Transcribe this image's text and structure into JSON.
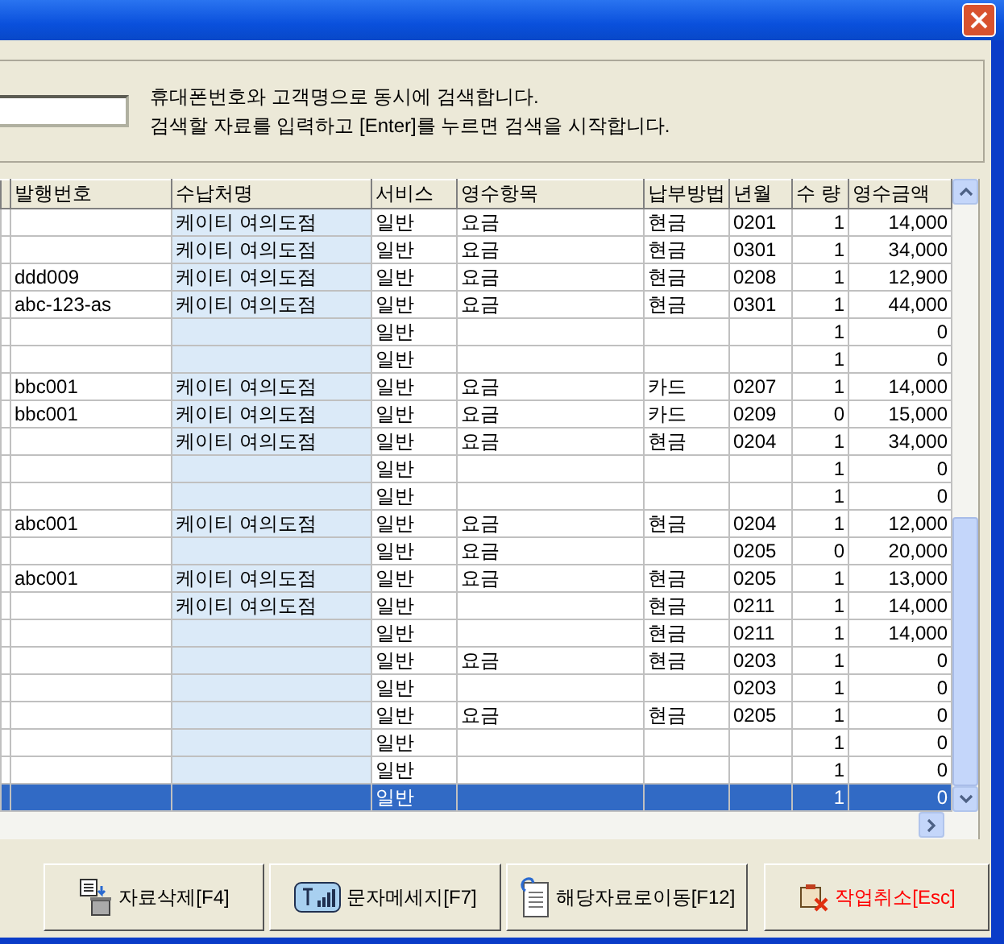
{
  "search": {
    "hint_lines": [
      "휴대폰번호와 고객명으로 동시에 검색합니다.",
      "검색할 자료를 입력하고 [Enter]를 누르면 검색을 시작합니다."
    ]
  },
  "table": {
    "columns": [
      "발행번호",
      "수납처명",
      "서비스",
      "영수항목",
      "납부방법",
      "년월",
      "수 량",
      "영수금액"
    ],
    "rows": [
      {
        "cells": [
          "",
          "케이티 여의도점",
          "일반",
          "요금",
          "현금",
          "0201",
          "1",
          "14,000"
        ],
        "selected": false
      },
      {
        "cells": [
          "",
          "케이티 여의도점",
          "일반",
          "요금",
          "현금",
          "0301",
          "1",
          "34,000"
        ],
        "selected": false
      },
      {
        "cells": [
          "ddd009",
          "케이티 여의도점",
          "일반",
          "요금",
          "현금",
          "0208",
          "1",
          "12,900"
        ],
        "selected": false
      },
      {
        "cells": [
          "abc-123-as",
          "케이티 여의도점",
          "일반",
          "요금",
          "현금",
          "0301",
          "1",
          "44,000"
        ],
        "selected": false
      },
      {
        "cells": [
          "",
          "",
          "일반",
          "",
          "",
          "",
          "1",
          "0"
        ],
        "selected": false
      },
      {
        "cells": [
          "",
          "",
          "일반",
          "",
          "",
          "",
          "1",
          "0"
        ],
        "selected": false
      },
      {
        "cells": [
          "bbc001",
          "케이티 여의도점",
          "일반",
          "요금",
          "카드",
          "0207",
          "1",
          "14,000"
        ],
        "selected": false
      },
      {
        "cells": [
          "bbc001",
          "케이티 여의도점",
          "일반",
          "요금",
          "카드",
          "0209",
          "0",
          "15,000"
        ],
        "selected": false
      },
      {
        "cells": [
          "",
          "케이티 여의도점",
          "일반",
          "요금",
          "현금",
          "0204",
          "1",
          "34,000"
        ],
        "selected": false
      },
      {
        "cells": [
          "",
          "",
          "일반",
          "",
          "",
          "",
          "1",
          "0"
        ],
        "selected": false
      },
      {
        "cells": [
          "",
          "",
          "일반",
          "",
          "",
          "",
          "1",
          "0"
        ],
        "selected": false
      },
      {
        "cells": [
          "abc001",
          "케이티 여의도점",
          "일반",
          "요금",
          "현금",
          "0204",
          "1",
          "12,000"
        ],
        "selected": false
      },
      {
        "cells": [
          "",
          "",
          "일반",
          "요금",
          "",
          "0205",
          "0",
          "20,000"
        ],
        "selected": false
      },
      {
        "cells": [
          "abc001",
          "케이티 여의도점",
          "일반",
          "요금",
          "현금",
          "0205",
          "1",
          "13,000"
        ],
        "selected": false
      },
      {
        "cells": [
          "",
          "케이티 여의도점",
          "일반",
          "",
          "현금",
          "0211",
          "1",
          "14,000"
        ],
        "selected": false
      },
      {
        "cells": [
          "",
          "",
          "일반",
          "",
          "현금",
          "0211",
          "1",
          "14,000"
        ],
        "selected": false
      },
      {
        "cells": [
          "",
          "",
          "일반",
          "요금",
          "현금",
          "0203",
          "1",
          "0"
        ],
        "selected": false
      },
      {
        "cells": [
          "",
          "",
          "일반",
          "",
          "",
          "0203",
          "1",
          "0"
        ],
        "selected": false
      },
      {
        "cells": [
          "",
          "",
          "일반",
          "요금",
          "현금",
          "0205",
          "1",
          "0"
        ],
        "selected": false
      },
      {
        "cells": [
          "",
          "",
          "일반",
          "",
          "",
          "",
          "1",
          "0"
        ],
        "selected": false
      },
      {
        "cells": [
          "",
          "",
          "일반",
          "",
          "",
          "",
          "1",
          "0"
        ],
        "selected": false
      },
      {
        "cells": [
          "",
          "",
          "일반",
          "",
          "",
          "",
          "1",
          "0"
        ],
        "selected": true
      }
    ]
  },
  "buttons": [
    {
      "label": "자료삭제[F4]",
      "kind": "delete"
    },
    {
      "label": "문자메세지[F7]",
      "kind": "sms"
    },
    {
      "label": "해당자료로이동[F12]",
      "kind": "goto"
    },
    {
      "label": "작업취소[Esc]",
      "kind": "cancel"
    }
  ]
}
